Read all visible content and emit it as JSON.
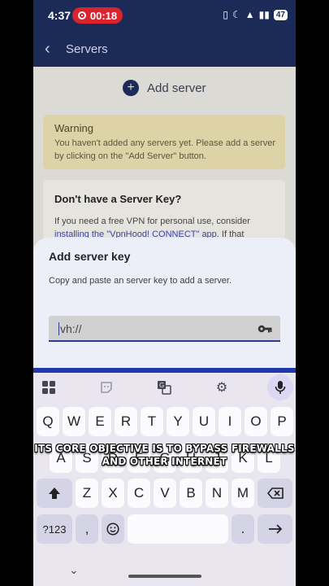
{
  "status": {
    "time": "4:37",
    "rec_time": "00:18",
    "battery": "47"
  },
  "appbar": {
    "title": "Servers"
  },
  "add_server_label": "Add server",
  "warning": {
    "title": "Warning",
    "text": "You haven't added any servers yet. Please add a server by clicking on the \"Add Server\" button."
  },
  "key_card": {
    "title": "Don't have a Server Key?",
    "text_before": "If you need a free VPN for personal use, consider ",
    "link": "installing the \"VpnHood! CONNECT\" app",
    "text_after": ". If that"
  },
  "sheet": {
    "title": "Add server key",
    "description": "Copy and paste an server key to add a server.",
    "input_value": "vh://"
  },
  "keyboard": {
    "row1": [
      "Q",
      "W",
      "E",
      "R",
      "T",
      "Y",
      "U",
      "I",
      "O",
      "P"
    ],
    "row2": [
      "A",
      "S",
      "D",
      "F",
      "G",
      "H",
      "J",
      "K",
      "L"
    ],
    "row3": [
      "Z",
      "X",
      "C",
      "V",
      "B",
      "N",
      "M"
    ],
    "symbols_key": "?123",
    "comma": ",",
    "period": "."
  },
  "caption": {
    "line1": "ITS CORE OBJECTIVE IS TO BYPASS FIREWALLS",
    "line2": "AND OTHER INTERNET"
  },
  "colors": {
    "appbar": "#1b2a57",
    "accent": "#2e3b8f",
    "warning_bg": "#ddd3a6"
  }
}
